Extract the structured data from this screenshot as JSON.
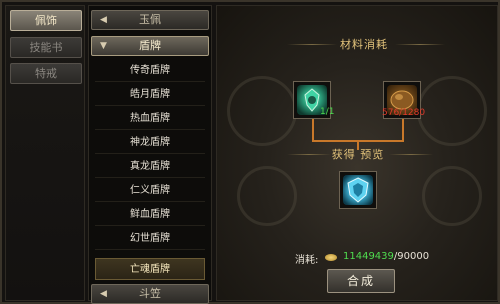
{
  "categories": [
    {
      "label": "佩饰",
      "active": true
    },
    {
      "label": "技能书",
      "active": false
    },
    {
      "label": "特戒",
      "active": false
    }
  ],
  "groups": {
    "top": {
      "label": "玉佩",
      "arrow": "◀"
    },
    "open": {
      "label": "盾牌",
      "arrow": "▼"
    },
    "bottom": {
      "label": "斗笠",
      "arrow": "◀"
    }
  },
  "items": [
    "传奇盾牌",
    "皓月盾牌",
    "热血盾牌",
    "神龙盾牌",
    "真龙盾牌",
    "仁义盾牌",
    "鲜血盾牌",
    "幻世盾牌",
    "亡魂盾牌"
  ],
  "selected_item": "亡魂盾牌",
  "panel": {
    "materials_title": "材料消耗",
    "preview_title": "获得 预览",
    "material1_count": "1/1",
    "material2_count": "576/1280",
    "cost_label": "消耗:",
    "cost_have": "11449439",
    "cost_need": "/90000",
    "craft_label": "合成"
  },
  "colors": {
    "accent_gold": "#e2c27a",
    "count_green": "#4fdc4f",
    "count_red": "#e03a2a",
    "connector": "#c8782a"
  }
}
